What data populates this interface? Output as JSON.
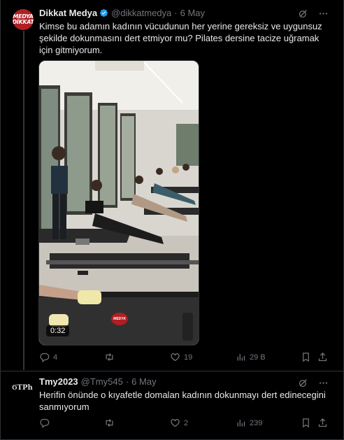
{
  "tweets": [
    {
      "display_name": "Dikkat Medya",
      "handle": "@dikkatmedya",
      "separator": "·",
      "date": "6 May",
      "avatar_text": "MEDYA DİKKAT",
      "text": "Kimse bu adamın kadının vücudunun her yerine gereksiz ve uygunsuz şekilde dokunmasını dert etmiyor mu? Pilates dersine tacize uğramak için gitmiyorum.",
      "video": {
        "duration": "0:32",
        "watermark": "MEDYA"
      },
      "stats": {
        "replies": "4",
        "retweets": "",
        "likes": "19",
        "views": "29 B"
      },
      "verified": true
    },
    {
      "display_name": "Tmy2023",
      "handle": "@Tmy545",
      "separator": "·",
      "date": "6 May",
      "avatar_text": "ϬΤΡh",
      "text": "Herifin önünde o kıyafetle domalan kadının dokunmayı dert edinecegini sanmıyorum",
      "stats": {
        "replies": "",
        "retweets": "",
        "likes": "2",
        "views": "239"
      },
      "verified": false
    }
  ],
  "icons": [
    "grok-icon",
    "more-icon",
    "reply-icon",
    "retweet-icon",
    "like-icon",
    "views-icon",
    "bookmark-icon",
    "share-icon",
    "verified-icon"
  ],
  "colors": {
    "background": "#000000",
    "text": "#e7e9ea",
    "muted": "#71767b",
    "verified": "#1d9bf0",
    "brand_red": "#b01e23"
  }
}
